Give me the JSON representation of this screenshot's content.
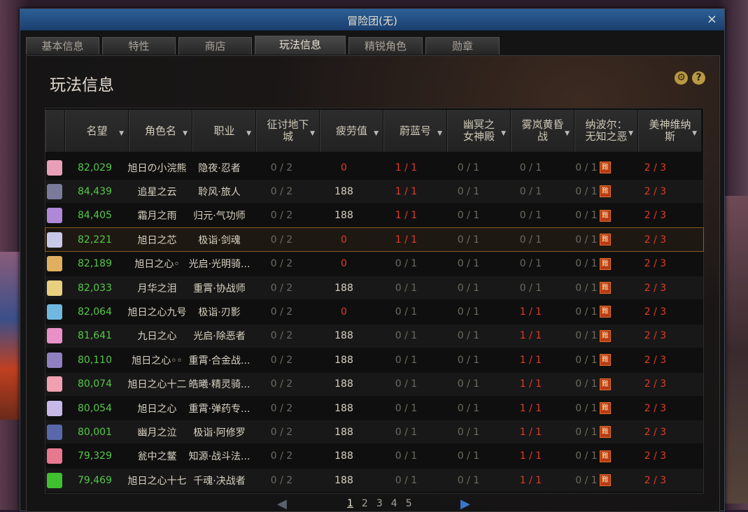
{
  "window": {
    "title": "冒险团(无)",
    "close": "×"
  },
  "tabs": [
    {
      "label": "基本信息"
    },
    {
      "label": "特性"
    },
    {
      "label": "商店"
    },
    {
      "label": "玩法信息"
    },
    {
      "label": "精锐角色"
    },
    {
      "label": "勋章"
    }
  ],
  "panel": {
    "title": "玩法信息",
    "gear": "⚙",
    "help": "?"
  },
  "columns": [
    {
      "label": ""
    },
    {
      "label": "名望"
    },
    {
      "label": "角色名"
    },
    {
      "label": "职业"
    },
    {
      "label": "征讨地下城"
    },
    {
      "label": "疲劳值"
    },
    {
      "label": "蔚蓝号"
    },
    {
      "label": "幽冥之女神殿"
    },
    {
      "label": "雾岚黄昏战"
    },
    {
      "label": "纳波尔：无知之恶"
    },
    {
      "label": "美神维纳斯"
    }
  ],
  "hard_badge": "難",
  "rows": [
    {
      "fame": "82,029",
      "name": "旭日の小浣熊",
      "job": "隐夜·忍者",
      "conquest": "0 / 2",
      "fatigue": "0",
      "azure": "1 / 1",
      "nether": "0 / 1",
      "mist": "0 / 1",
      "nabel": "0 / 1",
      "venus": "2 / 3",
      "avatar_color": "#e8a0b8"
    },
    {
      "fame": "84,439",
      "name": "追星之云",
      "job": "聆风·旅人",
      "conquest": "0 / 2",
      "fatigue": "188",
      "azure": "1 / 1",
      "nether": "0 / 1",
      "mist": "0 / 1",
      "nabel": "0 / 1",
      "venus": "2 / 3",
      "avatar_color": "#7a7a9a"
    },
    {
      "fame": "84,405",
      "name": "霜月之雨",
      "job": "归元·气功师",
      "conquest": "0 / 2",
      "fatigue": "188",
      "azure": "1 / 1",
      "nether": "0 / 1",
      "mist": "0 / 1",
      "nabel": "0 / 1",
      "venus": "2 / 3",
      "avatar_color": "#b088d8"
    },
    {
      "fame": "82,221",
      "name": "旭日之芯",
      "job": "极诣·剑魂",
      "conquest": "0 / 2",
      "fatigue": "0",
      "azure": "1 / 1",
      "nether": "0 / 1",
      "mist": "0 / 1",
      "nabel": "0 / 1",
      "venus": "2 / 3",
      "avatar_color": "#c8c8e8"
    },
    {
      "fame": "82,189",
      "name": "旭日之心◦",
      "job": "光启·光明骑...",
      "conquest": "0 / 2",
      "fatigue": "0",
      "azure": "0 / 1",
      "nether": "0 / 1",
      "mist": "0 / 1",
      "nabel": "0 / 1",
      "venus": "2 / 3",
      "avatar_color": "#e0b060"
    },
    {
      "fame": "82,033",
      "name": "月华之泪",
      "job": "重霄·协战师",
      "conquest": "0 / 2",
      "fatigue": "188",
      "azure": "0 / 1",
      "nether": "0 / 1",
      "mist": "0 / 1",
      "nabel": "0 / 1",
      "venus": "2 / 3",
      "avatar_color": "#e8d080"
    },
    {
      "fame": "82,064",
      "name": "旭日之心九号",
      "job": "极诣·刃影",
      "conquest": "0 / 2",
      "fatigue": "0",
      "azure": "0 / 1",
      "nether": "0 / 1",
      "mist": "1 / 1",
      "nabel": "0 / 1",
      "venus": "2 / 3",
      "avatar_color": "#70b8e0"
    },
    {
      "fame": "81,641",
      "name": "九日之心",
      "job": "光启·除恶者",
      "conquest": "0 / 2",
      "fatigue": "188",
      "azure": "0 / 1",
      "nether": "0 / 1",
      "mist": "1 / 1",
      "nabel": "0 / 1",
      "venus": "2 / 3",
      "avatar_color": "#e890c8"
    },
    {
      "fame": "80,110",
      "name": "旭日之心◦◦",
      "job": "重霄·合金战...",
      "conquest": "0 / 2",
      "fatigue": "188",
      "azure": "0 / 1",
      "nether": "0 / 1",
      "mist": "1 / 1",
      "nabel": "0 / 1",
      "venus": "2 / 3",
      "avatar_color": "#9080c0"
    },
    {
      "fame": "80,074",
      "name": "旭日之心十二",
      "job": "皓曦·精灵骑...",
      "conquest": "0 / 2",
      "fatigue": "188",
      "azure": "0 / 1",
      "nether": "0 / 1",
      "mist": "1 / 1",
      "nabel": "0 / 1",
      "venus": "2 / 3",
      "avatar_color": "#f0a0b0"
    },
    {
      "fame": "80,054",
      "name": "旭日之心",
      "job": "重霄·弹药专...",
      "conquest": "0 / 2",
      "fatigue": "188",
      "azure": "0 / 1",
      "nether": "0 / 1",
      "mist": "1 / 1",
      "nabel": "0 / 1",
      "venus": "2 / 3",
      "avatar_color": "#c8b8e8"
    },
    {
      "fame": "80,001",
      "name": "幽月之泣",
      "job": "极诣·阿修罗",
      "conquest": "0 / 2",
      "fatigue": "188",
      "azure": "0 / 1",
      "nether": "0 / 1",
      "mist": "1 / 1",
      "nabel": "0 / 1",
      "venus": "2 / 3",
      "avatar_color": "#5868a8"
    },
    {
      "fame": "79,329",
      "name": "瓮中之鳖",
      "job": "知源·战斗法...",
      "conquest": "0 / 2",
      "fatigue": "188",
      "azure": "0 / 1",
      "nether": "0 / 1",
      "mist": "1 / 1",
      "nabel": "0 / 1",
      "venus": "2 / 3",
      "avatar_color": "#e87890"
    },
    {
      "fame": "79,469",
      "name": "旭日之心十七",
      "job": "千魂·决战者",
      "conquest": "0 / 2",
      "fatigue": "188",
      "azure": "0 / 1",
      "nether": "0 / 1",
      "mist": "1 / 1",
      "nabel": "0 / 1",
      "venus": "2 / 3",
      "avatar_color": "#40c030"
    }
  ],
  "pager": {
    "prev": "◀",
    "next": "▶",
    "pages": [
      "1",
      "2",
      "3",
      "4",
      "5"
    ],
    "current": "1"
  }
}
